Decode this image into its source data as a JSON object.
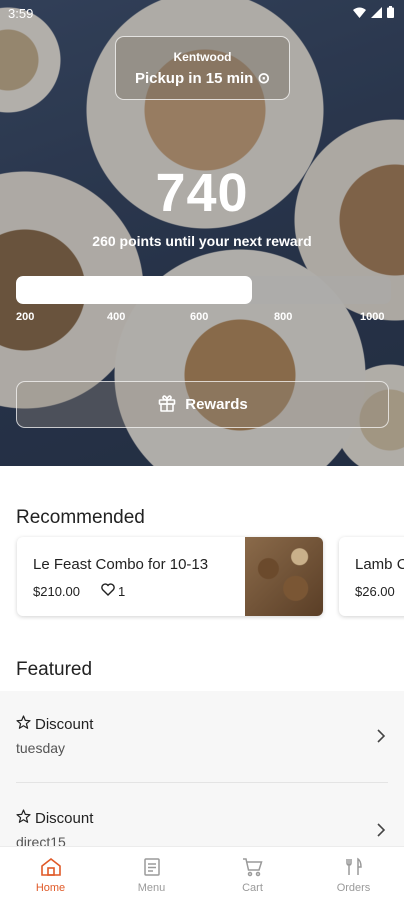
{
  "status": {
    "time": "3:59"
  },
  "pickup": {
    "location": "Kentwood",
    "time_label": "Pickup in 15 min ⊙"
  },
  "rewards": {
    "points": "740",
    "subtitle": "260 points until your next reward",
    "progress_fraction": 0.63,
    "ticks": [
      "200",
      "400",
      "600",
      "800",
      "1000"
    ],
    "button_label": "Rewards"
  },
  "recommended": {
    "title": "Recommended",
    "items": [
      {
        "name": "Le Feast Combo for 10-13",
        "price": "$210.00",
        "likes": "1"
      },
      {
        "name": "Lamb C",
        "price": "$26.00"
      }
    ]
  },
  "featured": {
    "title": "Featured",
    "items": [
      {
        "title": "Discount",
        "subtitle": "tuesday"
      },
      {
        "title": "Discount",
        "subtitle": "direct15"
      }
    ]
  },
  "nav": {
    "items": [
      {
        "label": "Home",
        "icon": "home-icon"
      },
      {
        "label": "Menu",
        "icon": "menu-icon"
      },
      {
        "label": "Cart",
        "icon": "cart-icon"
      },
      {
        "label": "Orders",
        "icon": "orders-icon"
      }
    ],
    "active_color": "#e05a28",
    "inactive_color": "#9a9a9a"
  }
}
